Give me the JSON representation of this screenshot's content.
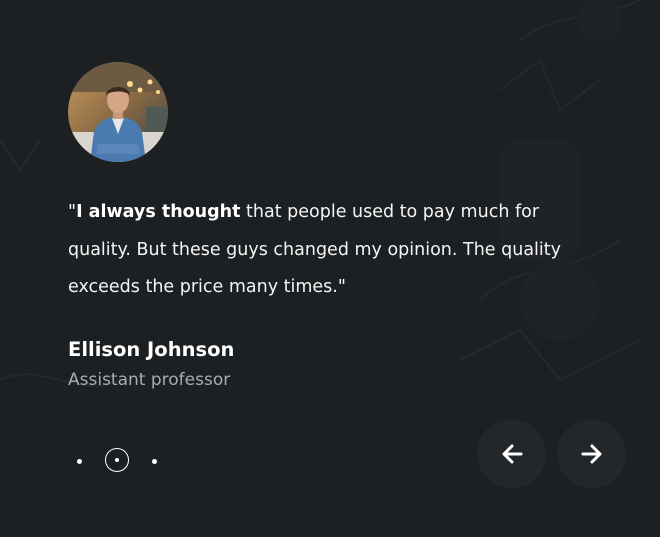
{
  "testimonial": {
    "avatar_icon": "portrait-photo",
    "quote_open": "\"",
    "quote_bold": "I always thought",
    "quote_rest": " that people used to pay much for quality. But these guys changed my opinion. The quality exceeds the price many times.",
    "quote_close": "\"",
    "name": "Ellison Johnson",
    "role": "Assistant professor"
  },
  "pagination": {
    "total": 3,
    "active_index": 2
  },
  "navigation": {
    "prev_icon": "arrow-left-icon",
    "next_icon": "arrow-right-icon"
  },
  "colors": {
    "background": "#1d2023",
    "button": "#24272a",
    "text": "#ffffff",
    "muted": "#a9acaf"
  }
}
